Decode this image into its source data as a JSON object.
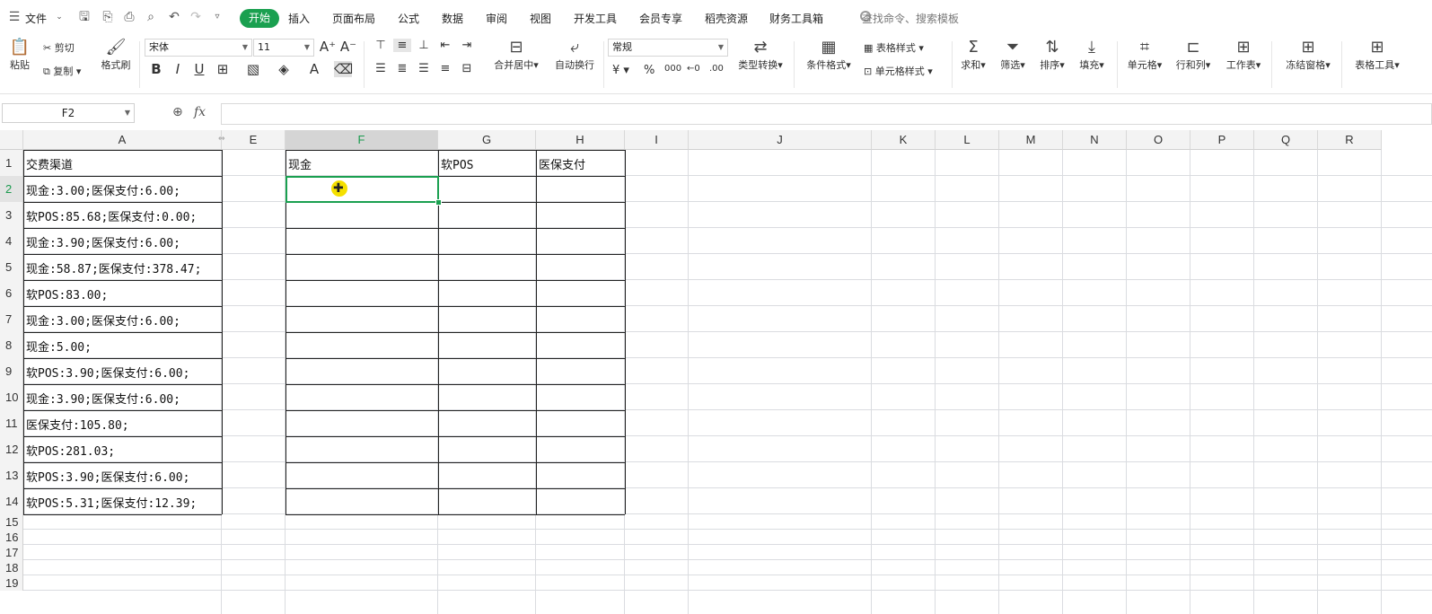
{
  "menubar": {
    "file": "文件",
    "tabs": [
      "开始",
      "插入",
      "页面布局",
      "公式",
      "数据",
      "审阅",
      "视图",
      "开发工具",
      "会员专享",
      "稻壳资源",
      "财务工具箱"
    ],
    "search_placeholder": "查找命令、搜索模板"
  },
  "ribbon": {
    "paste": "粘贴",
    "cut": "剪切",
    "copy": "复制",
    "format_painter": "格式刷",
    "font_name": "宋体",
    "font_size": "11",
    "merge_center": "合并居中",
    "wrap_text": "自动换行",
    "number_format": "常规",
    "type_convert": "类型转换",
    "cond_format": "条件格式",
    "table_style": "表格样式",
    "cell_style": "单元格样式",
    "sum": "求和",
    "filter": "筛选",
    "sort": "排序",
    "fill": "填充",
    "cell": "单元格",
    "row_col": "行和列",
    "worksheet": "工作表",
    "freeze": "冻结窗格",
    "table_tools": "表格工具"
  },
  "formula_bar": {
    "name_box": "F2",
    "fx": "fx",
    "content": ""
  },
  "columns": [
    "A",
    "E",
    "F",
    "G",
    "H",
    "I",
    "J",
    "K",
    "L",
    "M",
    "N",
    "O",
    "P",
    "Q",
    "R"
  ],
  "rows": [
    "1",
    "2",
    "3",
    "4",
    "5",
    "6",
    "7",
    "8",
    "9",
    "10",
    "11",
    "12",
    "13",
    "14",
    "15",
    "16",
    "17",
    "18",
    "19"
  ],
  "cells": {
    "A": [
      "交费渠道",
      "现金:3.00;医保支付:6.00;",
      "软POS:85.68;医保支付:0.00;",
      "现金:3.90;医保支付:6.00;",
      "现金:58.87;医保支付:378.47;",
      "软POS:83.00;",
      "现金:3.00;医保支付:6.00;",
      "现金:5.00;",
      "软POS:3.90;医保支付:6.00;",
      "现金:3.90;医保支付:6.00;",
      "医保支付:105.80;",
      "软POS:281.03;",
      "软POS:3.90;医保支付:6.00;",
      "软POS:5.31;医保支付:12.39;"
    ],
    "F1": "现金",
    "G1": "软POS",
    "H1": "医保支付"
  },
  "selection": {
    "cell": "F2",
    "accent": "#1aa050"
  }
}
